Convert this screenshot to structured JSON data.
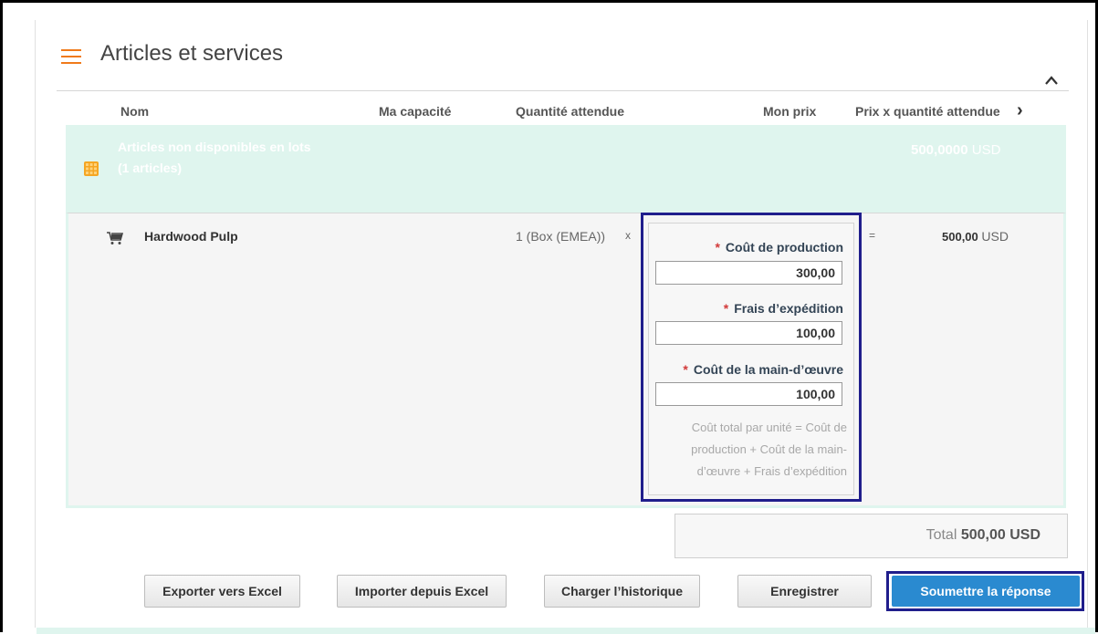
{
  "section": {
    "title": "Articles et services",
    "icon": "list-icon",
    "collapse_icon": "chevron-up-icon",
    "accent_color": "#f07a1a"
  },
  "columns": {
    "name": "Nom",
    "capacity": "Ma capacité",
    "expected_qty": "Quantité attendue",
    "my_price": "Mon prix",
    "extended": "Prix x quantité attendue",
    "next_icon": "chevron-right-icon"
  },
  "group": {
    "title": "Articles non disponibles en lots",
    "count": "(1 articles)",
    "total_value": "500,0000",
    "total_currency": "USD",
    "icon": "grid-icon",
    "band_color": "#dff5ee"
  },
  "item": {
    "name": "Hardwood Pulp",
    "icon": "cart-icon",
    "qty": "1 (Box (EMEA))",
    "times": "x",
    "equals": "=",
    "total_value": "500,00",
    "total_currency": "USD"
  },
  "price_fields": [
    {
      "label": "Coût de production",
      "value": "300,00",
      "required": "*"
    },
    {
      "label": "Frais d’expédition",
      "value": "100,00",
      "required": "*"
    },
    {
      "label": "Coût de la main-d’œuvre",
      "value": "100,00",
      "required": "*"
    }
  ],
  "formula": {
    "line1": "Coût total par unité = Coût de",
    "line2": "production + Coût de la main-",
    "line3": "d’œuvre + Frais d’expédition"
  },
  "total": {
    "label": "Total",
    "value": "500,00 USD"
  },
  "buttons": {
    "export": "Exporter vers Excel",
    "import": "Importer depuis Excel",
    "history": "Charger l’historique",
    "save": "Enregistrer",
    "submit": "Soumettre la réponse"
  },
  "colors": {
    "highlight": "#201e8c",
    "primary": "#2a8ad0",
    "required": "#d23a3a"
  }
}
